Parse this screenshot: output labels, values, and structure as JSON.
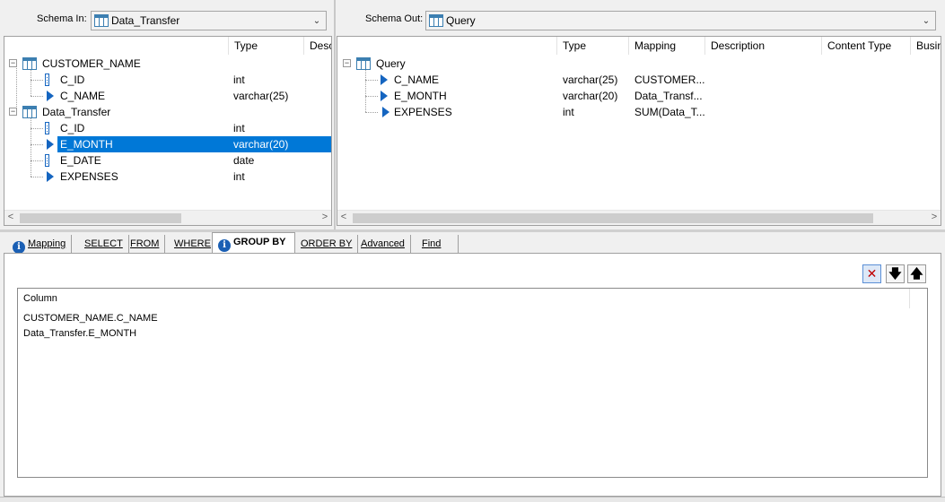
{
  "schema_in": {
    "label": "Schema In:",
    "selected": "Data_Transfer",
    "columns": [
      "Type",
      "Desc"
    ],
    "tree": [
      {
        "name": "CUSTOMER_NAME",
        "type": ""
      },
      {
        "name": "C_ID",
        "type": "int"
      },
      {
        "name": "C_NAME",
        "type": "varchar(25)"
      },
      {
        "name": "Data_Transfer",
        "type": ""
      },
      {
        "name": "C_ID",
        "type": "int"
      },
      {
        "name": "E_MONTH",
        "type": "varchar(20)"
      },
      {
        "name": "E_DATE",
        "type": "date"
      },
      {
        "name": "EXPENSES",
        "type": "int"
      }
    ]
  },
  "schema_out": {
    "label": "Schema Out:",
    "selected": "Query",
    "columns": [
      "Type",
      "Mapping",
      "Description",
      "Content Type",
      "Busin"
    ],
    "tree": [
      {
        "name": "Query",
        "type": "",
        "mapping": ""
      },
      {
        "name": "C_NAME",
        "type": "varchar(25)",
        "mapping": "CUSTOMER..."
      },
      {
        "name": "E_MONTH",
        "type": "varchar(20)",
        "mapping": "Data_Transf..."
      },
      {
        "name": "EXPENSES",
        "type": "int",
        "mapping": "SUM(Data_T..."
      }
    ]
  },
  "tabs": [
    "Mapping",
    "SELECT",
    "FROM",
    "WHERE",
    "GROUP BY",
    "ORDER BY",
    "Advanced",
    "Find"
  ],
  "active_tab": "GROUP BY",
  "group_by": {
    "column_header": "Column",
    "rows": [
      "CUSTOMER_NAME.C_NAME",
      "Data_Transfer.E_MONTH"
    ]
  },
  "toolbar": {
    "delete_glyph": "✕",
    "down_glyph": "🡇",
    "up_glyph": "🡅"
  },
  "colors": {
    "selection": "#0078d7",
    "icon_blue": "#1565c0",
    "delete_red": "#c00000"
  }
}
